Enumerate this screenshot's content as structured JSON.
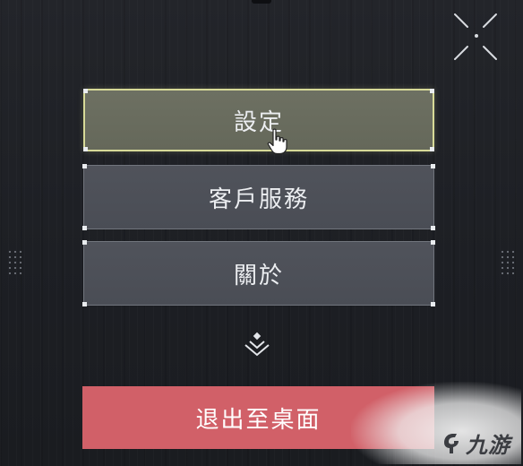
{
  "menu": {
    "settings_label": "設定",
    "customer_service_label": "客戶服務",
    "about_label": "關於",
    "quit_label": "退出至桌面"
  },
  "watermark": {
    "text": "九游"
  },
  "colors": {
    "background": "#1f2126",
    "selected_fill": "#6a6d5f",
    "selected_border": "#d7da98",
    "button_fill": "#4e5159",
    "quit_fill": "#d16068",
    "text": "#eceef1"
  },
  "icons": {
    "fullscreen": "fullscreen-icon",
    "expand": "chevron-double-down-icon",
    "pointer": "hand-pointer-icon",
    "logo": "jiuyou-logo-icon"
  }
}
